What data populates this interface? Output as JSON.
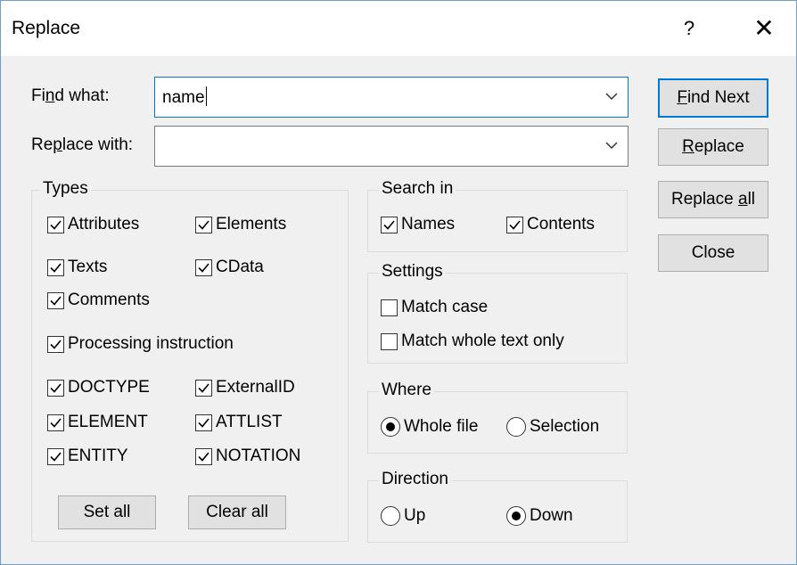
{
  "window": {
    "title": "Replace",
    "help_glyph": "?",
    "close_glyph": "✕"
  },
  "find": {
    "label_pre": "Fi",
    "label_key": "n",
    "label_post": "d what:",
    "value": "name"
  },
  "replace": {
    "label_pre": "Re",
    "label_key": "p",
    "label_post": "lace with:",
    "value": ""
  },
  "buttons": {
    "find_next": {
      "key": "F",
      "rest": "ind Next"
    },
    "replace": {
      "key": "R",
      "rest": "eplace"
    },
    "replace_all": {
      "pre": "Replace ",
      "key": "a",
      "rest": "ll"
    },
    "close": "Close"
  },
  "types": {
    "title": "Types",
    "items": [
      {
        "label": "Attributes",
        "checked": true
      },
      {
        "label": "Elements",
        "checked": true
      },
      {
        "label": "Texts",
        "checked": true
      },
      {
        "label": "CData",
        "checked": true
      },
      {
        "label": "Comments",
        "checked": true
      },
      {
        "label": "Processing instruction",
        "checked": true
      },
      {
        "label": "DOCTYPE",
        "checked": true
      },
      {
        "label": "ExternalID",
        "checked": true
      },
      {
        "label": "ELEMENT",
        "checked": true
      },
      {
        "label": "ATTLIST",
        "checked": true
      },
      {
        "label": "ENTITY",
        "checked": true
      },
      {
        "label": "NOTATION",
        "checked": true
      }
    ],
    "set_all": "Set all",
    "clear_all": "Clear all"
  },
  "search_in": {
    "title": "Search in",
    "items": [
      {
        "label": "Names",
        "checked": true
      },
      {
        "label": "Contents",
        "checked": true
      }
    ]
  },
  "settings": {
    "title": "Settings",
    "items": [
      {
        "label": "Match case",
        "checked": false
      },
      {
        "label": "Match whole text only",
        "checked": false
      }
    ]
  },
  "where": {
    "title": "Where",
    "options": [
      {
        "label": "Whole file",
        "selected": true
      },
      {
        "label": "Selection",
        "selected": false
      }
    ]
  },
  "direction": {
    "title": "Direction",
    "options": [
      {
        "label": "Up",
        "selected": false
      },
      {
        "label": "Down",
        "selected": true
      }
    ]
  }
}
